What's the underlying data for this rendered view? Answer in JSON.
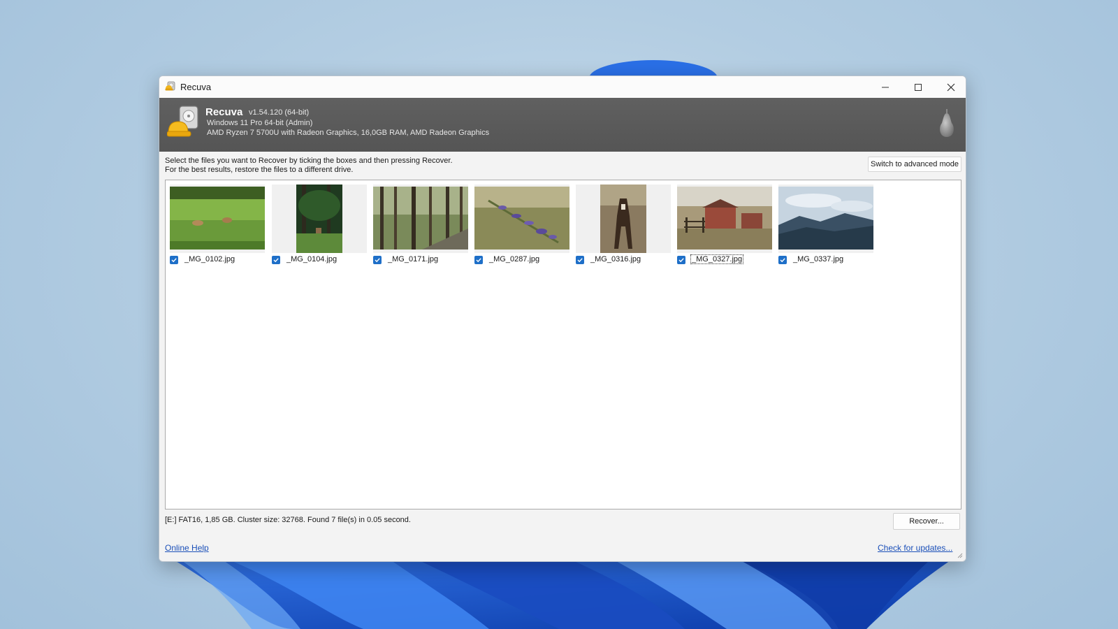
{
  "window": {
    "title": "Recuva",
    "minimize_icon": "minimize-icon",
    "maximize_icon": "maximize-icon",
    "close_icon": "close-icon"
  },
  "header": {
    "app_name": "Recuva",
    "version": "v1.54.120 (64-bit)",
    "os": "Windows 11 Pro 64-bit (Admin)",
    "hardware": "AMD Ryzen 7 5700U with Radeon Graphics, 16,0GB RAM, AMD Radeon Graphics",
    "logo_icon": "recuva-logo-icon",
    "brand_icon": "pear-icon"
  },
  "instructions": {
    "line1": "Select the files you want to Recover by ticking the boxes and then pressing Recover.",
    "line2": "For the best results, restore the files to a different drive."
  },
  "advanced_button": "Switch to advanced mode",
  "files": [
    {
      "name": "_MG_0102.jpg",
      "checked": true
    },
    {
      "name": "_MG_0104.jpg",
      "checked": true
    },
    {
      "name": "_MG_0171.jpg",
      "checked": true
    },
    {
      "name": "_MG_0287.jpg",
      "checked": true
    },
    {
      "name": "_MG_0316.jpg",
      "checked": true
    },
    {
      "name": "_MG_0327.jpg",
      "checked": true,
      "focused": true
    },
    {
      "name": "_MG_0337.jpg",
      "checked": true
    }
  ],
  "status": "[E:] FAT16, 1,85 GB. Cluster size: 32768. Found 7 file(s) in 0.05 second.",
  "recover_button": "Recover...",
  "links": {
    "help": "Online Help",
    "updates": "Check for updates..."
  },
  "colors": {
    "header_bg": "#5a5a5a",
    "checkbox": "#1e6fc8",
    "link": "#1a4fb8"
  }
}
